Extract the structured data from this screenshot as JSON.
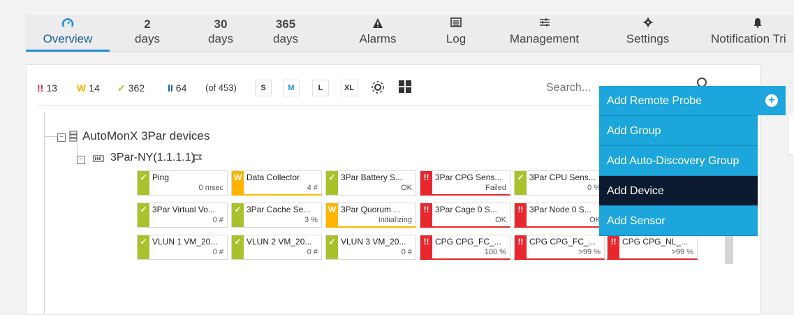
{
  "nav": {
    "tabs": [
      {
        "icon": "gauge-icon",
        "top": "",
        "label": "Overview"
      },
      {
        "top": "2",
        "label": "days"
      },
      {
        "top": "30",
        "label": "days"
      },
      {
        "top": "365",
        "label": "days"
      },
      {
        "icon": "alert-icon",
        "top": "",
        "label": "Alarms"
      },
      {
        "icon": "log-icon",
        "top": "",
        "label": "Log"
      },
      {
        "icon": "sliders-icon",
        "top": "",
        "label": "Management"
      },
      {
        "icon": "gear-icon",
        "top": "",
        "label": "Settings"
      },
      {
        "icon": "bell-icon",
        "top": "",
        "label": "Notification Tri"
      }
    ]
  },
  "toolbar": {
    "counts": [
      {
        "mark": "!!",
        "value": "13",
        "color": "#e8262d"
      },
      {
        "mark": "W",
        "value": "14",
        "color": "#ffb400"
      },
      {
        "mark": "✓",
        "value": "362",
        "color": "#a8c22b"
      },
      {
        "mark": "II",
        "value": "64",
        "color": "#1f5fa8"
      }
    ],
    "total": "(of 453)",
    "sizes": [
      "S",
      "M",
      "L",
      "XL"
    ],
    "selected_size": "M",
    "search_placeholder": "Search..."
  },
  "tree": {
    "group": "AutoMonX 3Par devices",
    "device": "3Par-NY(1.1.1.1)"
  },
  "sensors": [
    [
      {
        "status": "ok",
        "name": "Ping",
        "value": "0 msec"
      },
      {
        "status": "warn",
        "name": "Data Collector",
        "value": "4 #"
      },
      {
        "status": "ok",
        "name": "3Par Battery S...",
        "value": "OK"
      },
      {
        "status": "err",
        "name": "3Par CPG Sens...",
        "value": "Failed"
      },
      {
        "status": "ok",
        "name": "3Par CPU Sens...",
        "value": "0 %"
      }
    ],
    [
      {
        "status": "ok",
        "name": "3Par Virtual Vo...",
        "value": "0 #"
      },
      {
        "status": "ok",
        "name": "3Par Cache Se...",
        "value": "3 %"
      },
      {
        "status": "warn",
        "name": "3Par Quorum ...",
        "value": "Initializing"
      },
      {
        "status": "err",
        "name": "3Par Cage 0 S...",
        "value": "OK"
      },
      {
        "status": "err",
        "name": "3Par Node 0 S...",
        "value": "OK"
      }
    ],
    [
      {
        "status": "ok",
        "name": "VLUN 1 VM_20...",
        "value": "0 #"
      },
      {
        "status": "ok",
        "name": "VLUN 2 VM_20...",
        "value": "0 #"
      },
      {
        "status": "ok",
        "name": "VLUN 3 VM_20...",
        "value": "0 #"
      },
      {
        "status": "err",
        "name": "CPG CPG_FC_...",
        "value": "100 %"
      },
      {
        "status": "err",
        "name": "CPG CPG_FC_...",
        "value": ">99 %"
      },
      {
        "status": "err",
        "name": "CPG CPG_NL_...",
        "value": ">99 %"
      }
    ]
  ],
  "dropdown": {
    "items": [
      "Add Remote Probe",
      "Add Group",
      "Add Auto-Discovery Group",
      "Add Device",
      "Add Sensor"
    ],
    "highlighted": "Add Device"
  }
}
